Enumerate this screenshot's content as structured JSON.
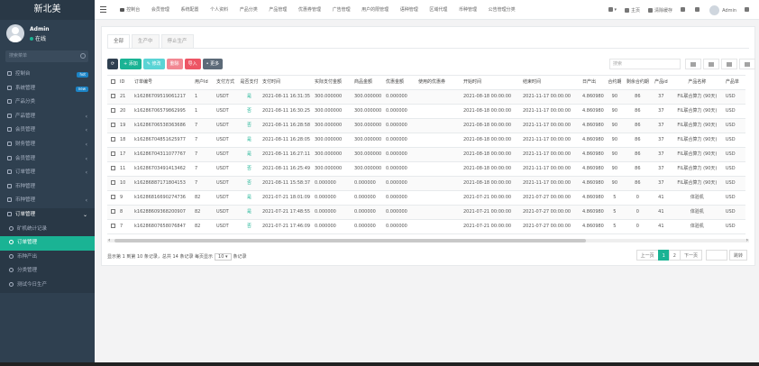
{
  "brand": "新北美",
  "profile": {
    "name": "Admin",
    "status": "在线"
  },
  "search": {
    "placeholder": "搜索菜单"
  },
  "sidebar": [
    {
      "label": "控制台",
      "badge": "hot",
      "badge_color": "#1c84c6"
    },
    {
      "label": "系统管理",
      "badge": "new",
      "badge_color": "#1c84c6"
    },
    {
      "label": "产品分类"
    },
    {
      "label": "产品管理",
      "arrow": "‹"
    },
    {
      "label": "会员管理",
      "arrow": "‹"
    },
    {
      "label": "财务管理",
      "arrow": "‹"
    },
    {
      "label": "会员管理",
      "arrow": "‹"
    },
    {
      "label": "订单管理",
      "arrow": "‹"
    },
    {
      "label": "币种管理"
    },
    {
      "label": "币种管理",
      "arrow": "‹"
    },
    {
      "label": "订单管理",
      "arrow": "⌄",
      "open": true
    }
  ],
  "submenu": [
    {
      "label": "矿机统计记录"
    },
    {
      "label": "订单管理",
      "active": true
    },
    {
      "label": "币种产出"
    },
    {
      "label": "分类管理"
    },
    {
      "label": "测试今日生产"
    }
  ],
  "topnav": [
    "控制台",
    "会员管理",
    "系统配置",
    "个人资料",
    "产品分类",
    "产品管理",
    "优惠券管理",
    "广告管理",
    "用户的限管理",
    "语种管理",
    "区域代理",
    "币种管理",
    "公告管理分类"
  ],
  "topright": {
    "home": "主页",
    "clear": "清除缓存",
    "user": "Admin"
  },
  "tabs": [
    "全部",
    "生产中",
    "停止生产"
  ],
  "toolbar": {
    "add": "+ 添加",
    "edit": "✎ 修改",
    "delete": "删除",
    "import": "导入",
    "more": "• 更多"
  },
  "table_search": {
    "placeholder": "搜索"
  },
  "table": {
    "headers": [
      "ID",
      "订单编号",
      "用户Id",
      "支付方式",
      "是否支付",
      "支付时间",
      "实际支付金额",
      "商品金额",
      "优惠金额",
      "使用的优惠券",
      "开始时间",
      "结束时间",
      "日产出",
      "合约期",
      "剩余合约期",
      "产品id",
      "产品名称",
      "产品单"
    ],
    "rows": [
      [
        "21",
        "k16286709519061217",
        "1",
        "USDT",
        "是",
        "2021-08-11 16:31:35",
        "300.000000",
        "300.000000",
        "0.000000",
        "",
        "2021-08-18 00:00:00",
        "2021-11-17 00:00:00",
        "4.860980",
        "90",
        "86",
        "37",
        "FIL联合算力 (90天)",
        "USD"
      ],
      [
        "20",
        "k16286706579862995",
        "1",
        "USDT",
        "否",
        "2021-08-11 16:30:25",
        "300.000000",
        "300.000000",
        "0.000000",
        "",
        "2021-08-18 00:00:00",
        "2021-11-17 00:00:00",
        "4.860980",
        "90",
        "86",
        "37",
        "FIL联合算力 (90天)",
        "USD"
      ],
      [
        "19",
        "k16286706538363686",
        "7",
        "USDT",
        "否",
        "2021-08-11 16:28:58",
        "300.000000",
        "300.000000",
        "0.000000",
        "",
        "2021-08-18 00:00:00",
        "2021-11-17 00:00:00",
        "4.860980",
        "90",
        "86",
        "37",
        "FIL联合算力 (90天)",
        "USD"
      ],
      [
        "18",
        "k16286704851625977",
        "7",
        "USDT",
        "是",
        "2021-08-11 16:28:05",
        "300.000000",
        "300.000000",
        "0.000000",
        "",
        "2021-08-18 00:00:00",
        "2021-11-17 00:00:00",
        "4.860980",
        "90",
        "86",
        "37",
        "FIL联合算力 (90天)",
        "USD"
      ],
      [
        "17",
        "k16286704311077767",
        "7",
        "USDT",
        "是",
        "2021-08-11 16:27:11",
        "300.000000",
        "300.000000",
        "0.000000",
        "",
        "2021-08-18 00:00:00",
        "2021-11-17 00:00:00",
        "4.860980",
        "90",
        "86",
        "37",
        "FIL联合算力 (90天)",
        "USD"
      ],
      [
        "11",
        "k16286703491413462",
        "7",
        "USDT",
        "否",
        "2021-08-11 16:25:49",
        "300.000000",
        "300.000000",
        "0.000000",
        "",
        "2021-08-18 00:00:00",
        "2021-11-17 00:00:00",
        "4.860980",
        "90",
        "86",
        "37",
        "FIL联合算力 (90天)",
        "USD"
      ],
      [
        "10",
        "k16286887171804153",
        "7",
        "USDT",
        "否",
        "2021-08-11 15:58:37",
        "0.000000",
        "0.000000",
        "0.000000",
        "",
        "2021-08-18 00:00:00",
        "2021-11-17 00:00:00",
        "4.860980",
        "90",
        "86",
        "37",
        "FIL联合算力 (90天)",
        "USD"
      ],
      [
        "9",
        "k16286816690274736",
        "82",
        "USDT",
        "是",
        "2021-07-21 18:01:09",
        "0.000000",
        "0.000000",
        "0.000000",
        "",
        "2021-07-21 00:00:00",
        "2021-07-27 00:00:00",
        "4.860980",
        "5",
        "0",
        "41",
        "体验机",
        "USD"
      ],
      [
        "8",
        "k16288609368200907",
        "82",
        "USDT",
        "是",
        "2021-07-21 17:48:55",
        "0.000000",
        "0.000000",
        "0.000000",
        "",
        "2021-07-21 00:00:00",
        "2021-07-27 00:00:00",
        "4.860980",
        "5",
        "0",
        "41",
        "体验机",
        "USD"
      ],
      [
        "7",
        "k16286807658076847",
        "82",
        "USDT",
        "否",
        "2021-07-21 17:46:09",
        "0.000000",
        "0.000000",
        "0.000000",
        "",
        "2021-07-21 00:00:00",
        "2021-07-27 00:00:00",
        "4.860980",
        "5",
        "0",
        "41",
        "体验机",
        "USD"
      ]
    ]
  },
  "footer": {
    "text1": "显示第 1 到第 10 条记录，总共 14 条记录 每页显示",
    "page_size": "10 ▾",
    "text2": "条记录"
  },
  "pager": {
    "prev": "上一页",
    "pages": [
      "1",
      "2"
    ],
    "next": "下一页",
    "go": "跳转"
  },
  "colors": {
    "sidebar": "#2f4050",
    "accent": "#1ab394",
    "danger": "#ed5565"
  }
}
